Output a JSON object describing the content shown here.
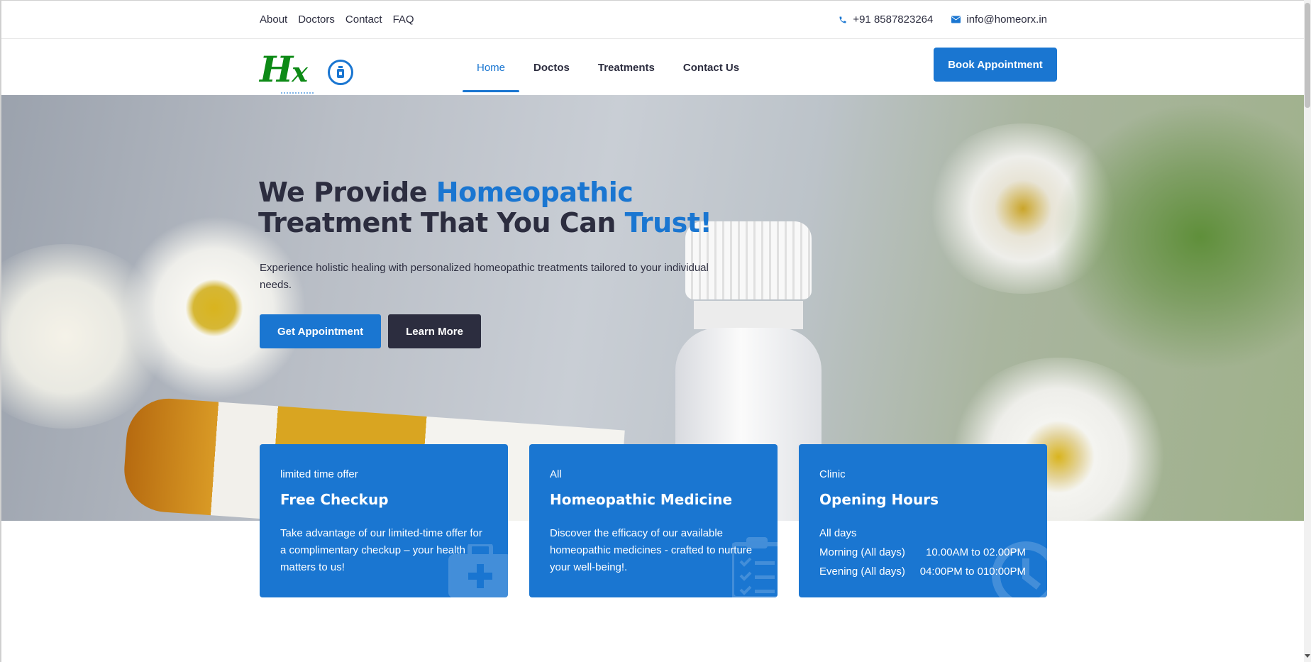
{
  "topbar": {
    "links": [
      "About",
      "Doctors",
      "Contact",
      "FAQ"
    ],
    "phone": "+91 8587823264",
    "email": "info@homeorx.in",
    "icons": {
      "phone": "phone-icon",
      "email": "envelope-icon"
    }
  },
  "header": {
    "logo_text": "Hx",
    "nav": [
      {
        "label": "Home",
        "active": true
      },
      {
        "label": "Doctos",
        "active": false
      },
      {
        "label": "Treatments",
        "active": false
      },
      {
        "label": "Contact Us",
        "active": false
      }
    ],
    "book_button": "Book Appointment"
  },
  "hero": {
    "title_part1": "We Provide ",
    "title_accent1": "Homeopathic",
    "title_part2": "Treatment That You Can ",
    "title_accent2": "Trust!",
    "description": "Experience holistic healing with personalized homeopathic treatments tailored to your individual needs.",
    "primary_button": "Get Appointment",
    "secondary_button": "Learn More"
  },
  "cards": [
    {
      "kicker": "limited time offer",
      "title": "Free Checkup",
      "text": "Take advantage of our limited-time offer for a complimentary checkup – your health matters to us!",
      "icon": "first-aid-icon"
    },
    {
      "kicker": "All",
      "title": "Homeopathic Medicine",
      "text": "Discover the efficacy of our available homeopathic medicines - crafted to nurture your well-being!.",
      "icon": "clipboard-list-icon"
    },
    {
      "kicker": "Clinic",
      "title": "Opening Hours",
      "hours_heading": "All days",
      "hours": [
        {
          "label": "Morning (All days)",
          "time": "10.00AM to 02.00PM"
        },
        {
          "label": "Evening (All days)",
          "time": "04:00PM to 010:00PM"
        }
      ],
      "icon": "clock-icon"
    }
  ],
  "colors": {
    "accent": "#1a76d1",
    "dark": "#2c2d3f",
    "logo_green": "#0d8a16"
  }
}
